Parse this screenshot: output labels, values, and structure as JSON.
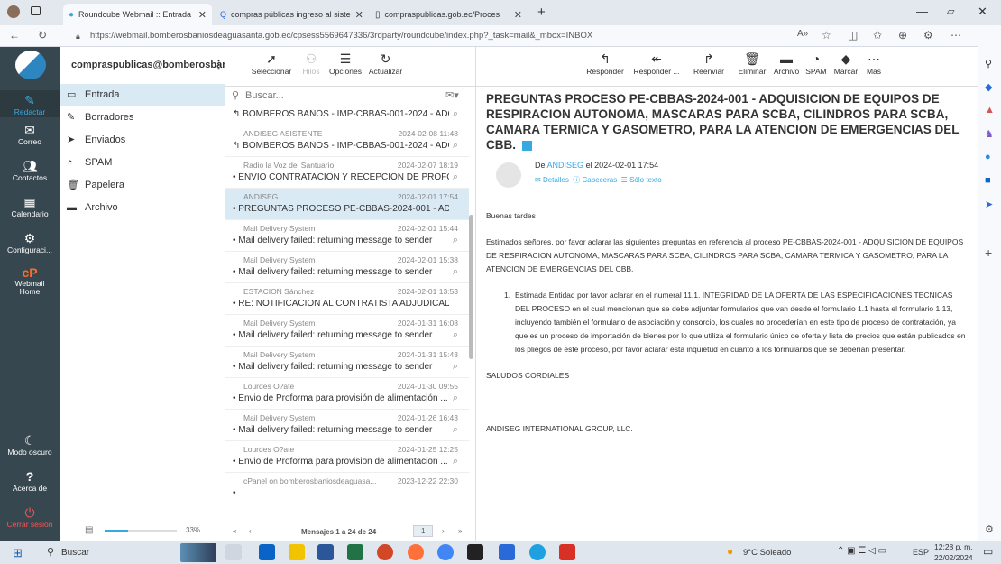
{
  "browser": {
    "tabs": [
      {
        "title": "Roundcube Webmail :: Entrada",
        "icon": "roundcube-icon"
      },
      {
        "title": "compras públicas ingreso al siste",
        "icon": "search-icon"
      },
      {
        "title": "compraspublicas.gob.ec/Proces",
        "icon": "page-icon"
      }
    ],
    "url": "https://webmail.bomberosbaniosdeaguasanta.gob.ec/cpsess5569647336/3rdparty/roundcube/index.php?_task=mail&_mbox=INBOX"
  },
  "appnav": {
    "items": [
      {
        "label": "Redactar",
        "icon": "compose-icon"
      },
      {
        "label": "Correo",
        "icon": "mail-icon"
      },
      {
        "label": "Contactos",
        "icon": "contacts-icon"
      },
      {
        "label": "Calendario",
        "icon": "calendar-icon"
      },
      {
        "label": "Configuraci...",
        "icon": "gear-icon"
      },
      {
        "label": "Webmail Home",
        "icon": "cpanel-icon"
      },
      {
        "label": "Modo oscuro",
        "icon": "moon-icon"
      },
      {
        "label": "Acerca de",
        "icon": "help-icon"
      },
      {
        "label": "Cerrar sesión",
        "icon": "power-icon"
      }
    ]
  },
  "account": "compraspublicas@bomberosbani...",
  "folders": [
    {
      "label": "Entrada",
      "icon": "inbox-icon"
    },
    {
      "label": "Borradores",
      "icon": "pencil-icon"
    },
    {
      "label": "Enviados",
      "icon": "sent-icon"
    },
    {
      "label": "SPAM",
      "icon": "spam-icon"
    },
    {
      "label": "Papelera",
      "icon": "trash-icon"
    },
    {
      "label": "Archivo",
      "icon": "archive-icon"
    }
  ],
  "quota": {
    "percent": "33%",
    "fill": 0.33
  },
  "listtoolbar": {
    "select": "Seleccionar",
    "threads": "Hilos",
    "options": "Opciones",
    "refresh": "Actualizar"
  },
  "search_placeholder": "Buscar...",
  "messages": [
    {
      "from": "",
      "date": "",
      "subject": "BOMBEROS BAÑOS - IMP-CBBAS-001-2024 - ADQ...",
      "attachment": true,
      "replied": true
    },
    {
      "from": "ANDISEG ASISTENTE",
      "date": "2024-02-08 11:48",
      "subject": "BOMBEROS BAÑOS - IMP-CBBAS-001-2024 - ADQ...",
      "attachment": true,
      "replied": true
    },
    {
      "from": "Radio la Voz del Santuario",
      "date": "2024-02-07 18:19",
      "subject": "ENVIO CONTRATACION Y RECEPCION DE PROFO...",
      "attachment": true,
      "replied": false
    },
    {
      "from": "ANDISEG",
      "date": "2024-02-01 17:54",
      "subject": "PREGUNTAS PROCESO PE-CBBAS-2024-001 - ADQ...",
      "attachment": false,
      "replied": false
    },
    {
      "from": "Mail Delivery System",
      "date": "2024-02-01 15:44",
      "subject": "Mail delivery failed: returning message to sender",
      "attachment": true,
      "replied": false
    },
    {
      "from": "Mail Delivery System",
      "date": "2024-02-01 15:38",
      "subject": "Mail delivery failed: returning message to sender",
      "attachment": true,
      "replied": false
    },
    {
      "from": "ESTACION Sánchez",
      "date": "2024-02-01 13:53",
      "subject": "RE: NOTIFICACION AL CONTRATISTA ADJUDICAD...",
      "attachment": false,
      "replied": false
    },
    {
      "from": "Mail Delivery System",
      "date": "2024-01-31 16:08",
      "subject": "Mail delivery failed: returning message to sender",
      "attachment": true,
      "replied": false
    },
    {
      "from": "Mail Delivery System",
      "date": "2024-01-31 15:43",
      "subject": "Mail delivery failed: returning message to sender",
      "attachment": true,
      "replied": false
    },
    {
      "from": "Lourdes O?ate",
      "date": "2024-01-30 09:55",
      "subject": "Envio de Proforma para provisión de alimentación ...",
      "attachment": true,
      "replied": false
    },
    {
      "from": "Mail Delivery System",
      "date": "2024-01-26 16:43",
      "subject": "Mail delivery failed: returning message to sender",
      "attachment": true,
      "replied": false
    },
    {
      "from": "Lourdes O?ate",
      "date": "2024-01-25 12:25",
      "subject": "Envio de Proforma para provision de alimentacion ...",
      "attachment": true,
      "replied": false
    },
    {
      "from": "cPanel on bomberosbaniosdeaguasa...",
      "date": "2023-12-22 22:30",
      "subject": "",
      "attachment": false,
      "replied": false
    }
  ],
  "pager": {
    "text": "Mensajes 1 a 24 de 24",
    "page": "1"
  },
  "readtoolbar": {
    "reply": "Responder",
    "reply_all": "Responder ...",
    "forward": "Reenviar",
    "delete": "Eliminar",
    "archive": "Archivo",
    "spam": "SPAM",
    "mark": "Marcar",
    "more": "Más"
  },
  "email": {
    "subject": "PREGUNTAS PROCESO PE-CBBAS-2024-001 - ADQUISICION DE EQUIPOS DE RESPIRACION AUTONOMA, MASCARAS PARA SCBA, CILINDROS PARA SCBA, CAMARA TERMICA Y GASOMETRO, PARA LA ATENCION DE EMERGENCIAS DEL CBB.",
    "from_prefix": "De",
    "sender": "ANDISEG",
    "date_text": "el 2024-02-01 17:54",
    "details": "Detalles",
    "headers": "Cabeceras",
    "plain": "Sólo texto",
    "greeting": "Buenas tardes",
    "intro": "Estimados señores, por favor aclarar las siguientes preguntas en referencia al proceso PE-CBBAS-2024-001 - ADQUISICION DE EQUIPOS DE RESPIRACION AUTONOMA, MASCARAS PARA SCBA, CILINDROS PARA SCBA, CAMARA TERMICA Y GASOMETRO, PARA LA ATENCION DE EMERGENCIAS DEL CBB.",
    "question": "Estimada Entidad por favor aclarar en el numeral 11.1. INTEGRIDAD DE LA OFERTA DE LAS ESPECIFICACIONES TECNICAS DEL PROCESO en el cual mencionan que se debe adjuntar formularios que van desde el formulario 1.1 hasta el formulario 1.13, incluyendo también el formulario de asociación y consorcio, los cuales no procederían en este tipo de proceso de contratación, ya que es un proceso de importación de bienes por lo que utiliza el formulario único de oferta y lista de precios que están publicados en los pliegos de este proceso, por favor aclarar esta inquietud en cuanto a los formularios que se deberían presentar.",
    "closing": "SALUDOS CORDIALES",
    "signature": "ANDISEG INTERNATIONAL GROUP, LLC."
  },
  "taskbar": {
    "search": "Buscar",
    "weather": "9°C Soleado",
    "lang": "ESP",
    "time": "12:28 p. m.",
    "date": "22/02/2024"
  },
  "colors": {
    "nav": "#37474f",
    "accent": "#37a9e1",
    "selected": "#d9eaf5",
    "logout": "#ff5252"
  }
}
